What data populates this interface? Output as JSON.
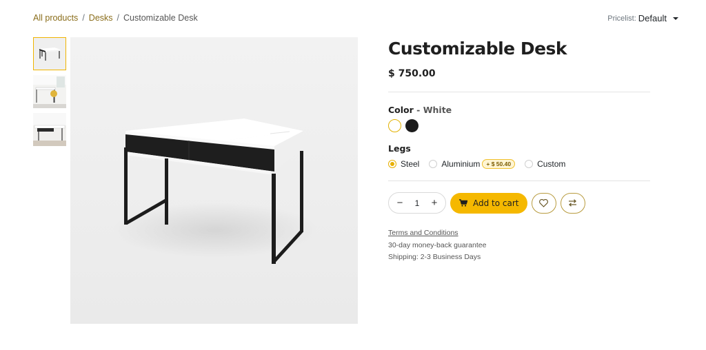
{
  "breadcrumb": {
    "items": [
      "All products",
      "Desks"
    ],
    "separator": "/",
    "current": "Customizable Desk"
  },
  "pricelist": {
    "label": "Pricelist:",
    "value": "Default"
  },
  "product": {
    "title": "Customizable Desk",
    "price": "$ 750.00"
  },
  "color_attr": {
    "label": "Color",
    "dash": "-",
    "selected": "White",
    "swatches": [
      {
        "name": "White",
        "hex": "#ffffff",
        "selected": true
      },
      {
        "name": "Black",
        "hex": "#1b1b1b",
        "selected": false
      }
    ]
  },
  "legs_attr": {
    "label": "Legs",
    "options": [
      {
        "label": "Steel",
        "checked": true
      },
      {
        "label": "Aluminium",
        "checked": false,
        "extra": "+ $ 50.40"
      },
      {
        "label": "Custom",
        "checked": false
      }
    ]
  },
  "cart": {
    "minus": "−",
    "quantity": "1",
    "plus": "+",
    "add_label": "Add to cart"
  },
  "info_links": {
    "terms": "Terms and Conditions",
    "guarantee": "30-day money-back guarantee",
    "shipping": "Shipping: 2-3 Business Days"
  },
  "colors": {
    "accent": "#f5b800",
    "link": "#8a6d1a"
  }
}
